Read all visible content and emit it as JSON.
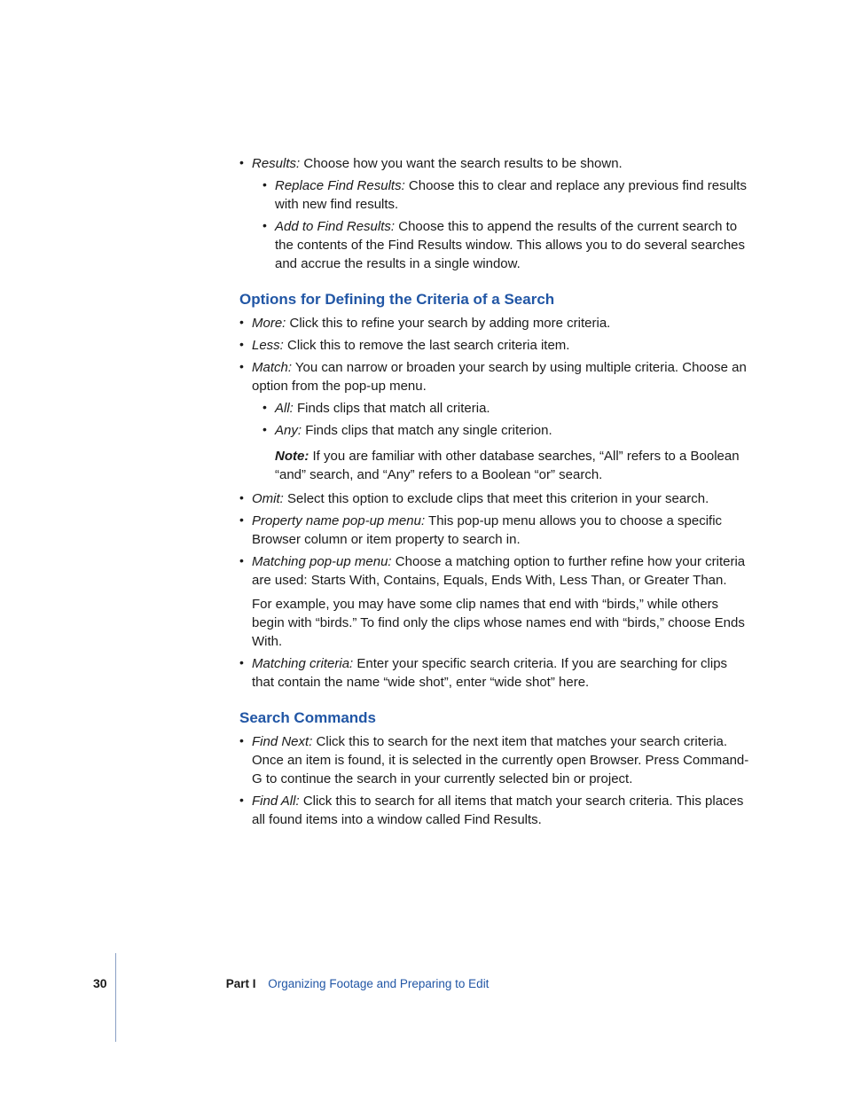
{
  "sections": {
    "results": {
      "label": "Results:",
      "text": "Choose how you want the search results to be shown.",
      "sub": [
        {
          "label": "Replace Find Results:",
          "text": "Choose this to clear and replace any previous find results with new find results."
        },
        {
          "label": "Add to Find Results:",
          "text": "Choose this to append the results of the current search to the contents of the Find Results window. This allows you to do several searches and accrue the results in a single window."
        }
      ]
    },
    "options_heading": "Options for Defining the Criteria of a Search",
    "options": [
      {
        "label": "More:",
        "text": "Click this to refine your search by adding more criteria."
      },
      {
        "label": "Less:",
        "text": "Click this to remove the last search criteria item."
      },
      {
        "label": "Match:",
        "text": "You can narrow or broaden your search by using multiple criteria. Choose an option from the pop-up menu.",
        "sub": [
          {
            "label": "All:",
            "text": "Finds clips that match all criteria."
          },
          {
            "label": "Any:",
            "text": "Finds clips that match any single criterion."
          }
        ],
        "note_label": "Note:",
        "note_text": "If you are familiar with other database searches, “All” refers to a Boolean “and” search, and “Any” refers to a Boolean “or” search."
      },
      {
        "label": "Omit:",
        "text": "Select this option to exclude clips that meet this criterion in your search."
      },
      {
        "label": "Property name pop-up menu:",
        "text": "This pop-up menu allows you to choose a specific Browser column or item property to search in."
      },
      {
        "label": "Matching pop-up menu:",
        "text": "Choose a matching option to further refine how your criteria are used: Starts With, Contains, Equals, Ends With, Less Than, or Greater Than.",
        "after": "For example, you may have some clip names that end with “birds,” while others begin with “birds.” To find only the clips whose names end with “birds,” choose Ends With."
      },
      {
        "label": "Matching criteria:",
        "text": "Enter your specific search criteria. If you are searching for clips that contain the name “wide shot”, enter “wide shot” here."
      }
    ],
    "search_heading": "Search Commands",
    "search": [
      {
        "label": "Find Next:",
        "text": "Click this to search for the next item that matches your search criteria. Once an item is found, it is selected in the currently open Browser. Press Command-G to continue the search in your currently selected bin or project."
      },
      {
        "label": "Find All:",
        "text": "Click this to search for all items that match your search criteria. This places all found items into a window called Find Results."
      }
    ]
  },
  "footer": {
    "page": "30",
    "part_label": "Part I",
    "part_title": "Organizing Footage and Preparing to Edit"
  }
}
